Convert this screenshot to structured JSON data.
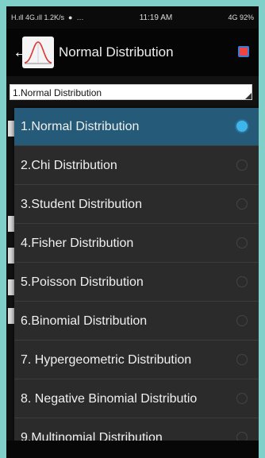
{
  "statusbar": {
    "left": "H.ıll 4G.ıll  1.2K/s",
    "icons": "…",
    "time": "11:19 AM",
    "right": "4G 92%"
  },
  "appbar": {
    "title": "Normal Distribution",
    "logo_icon": "bell-curve-icon",
    "back_icon": "arrow-left-icon",
    "action_icon": "record-icon"
  },
  "spinner": {
    "selected": "1.Normal Distribution"
  },
  "options": [
    {
      "label": "1.Normal Distribution",
      "selected": true
    },
    {
      "label": "2.Chi Distribution",
      "selected": false
    },
    {
      "label": "3.Student Distribution",
      "selected": false
    },
    {
      "label": "4.Fisher Distribution",
      "selected": false
    },
    {
      "label": "5.Poisson Distribution",
      "selected": false
    },
    {
      "label": "6.Binomial Distribution",
      "selected": false
    },
    {
      "label": "7. Hypergeometric Distribution",
      "selected": false
    },
    {
      "label": "8. Negative Binomial Distributio",
      "selected": false
    },
    {
      "label": "9.Multinomial Distribution",
      "selected": false
    }
  ],
  "colors": {
    "selected_bg": "#255a78",
    "radio_on": "#3fb6ea",
    "frame": "#7fd0c8"
  }
}
